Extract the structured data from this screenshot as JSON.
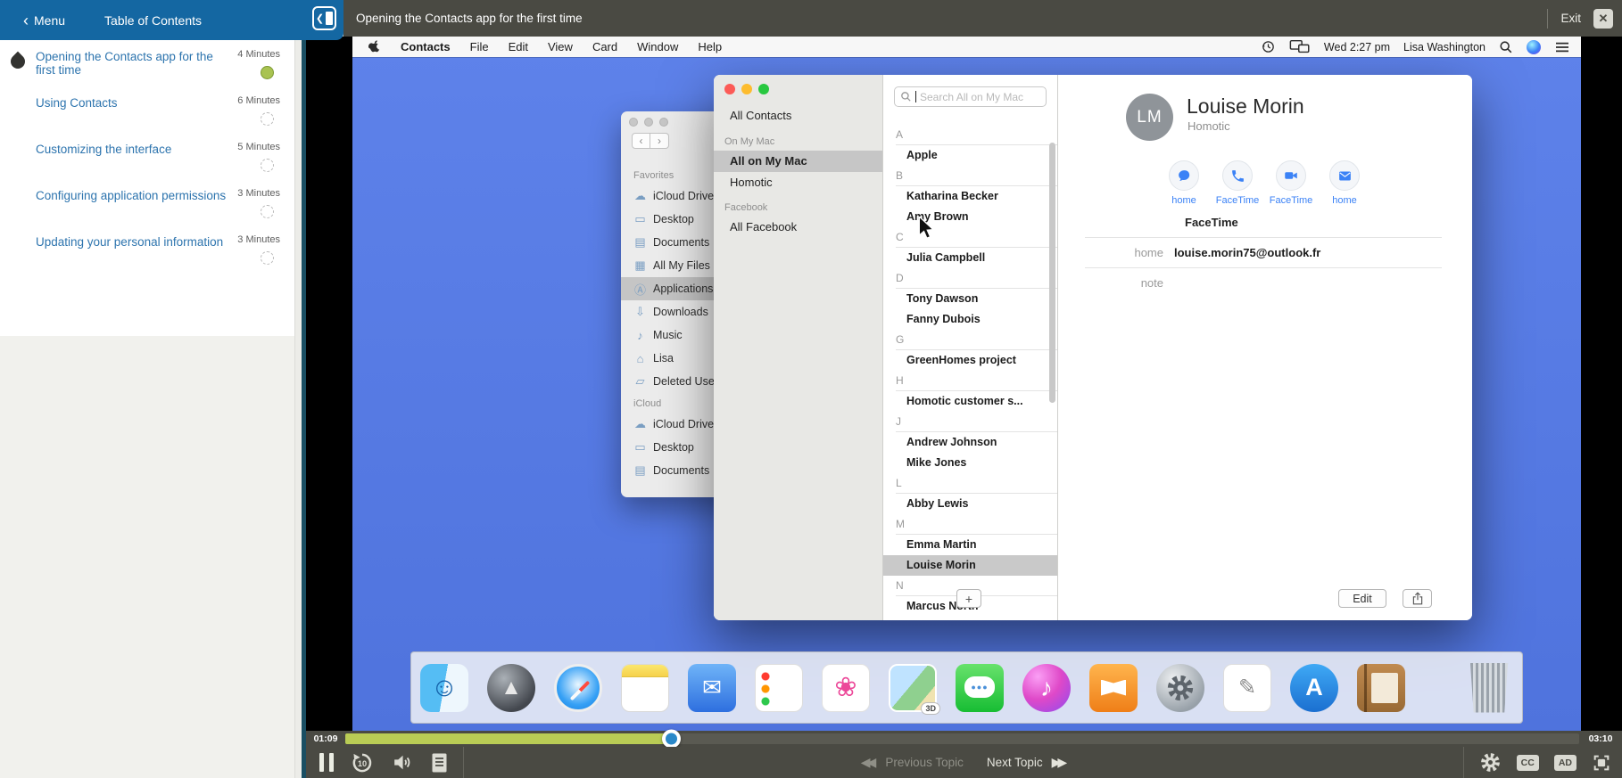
{
  "colors": {
    "header_blue": "#1467a2",
    "toolbar_olive": "#4a4a43",
    "progress_green": "#b9cc55",
    "progress_handle_blue": "#2a88c9",
    "desktop_blue": "#567ae4",
    "toc_link_blue": "#2d74ae",
    "status_done_green": "#a9c351",
    "selection_gray": "#c9c9c9",
    "accent_blue": "#3b82f6"
  },
  "header": {
    "menu_label": "Menu",
    "toc_label": "Table of Contents",
    "lesson_title": "Opening the Contacts app for the first time",
    "exit_label": "Exit"
  },
  "toc": {
    "items": [
      {
        "title": "Opening the Contacts app for the first time",
        "duration": "4 Minutes",
        "status": "current"
      },
      {
        "title": "Using Contacts",
        "duration": "6 Minutes",
        "status": "not-started"
      },
      {
        "title": "Customizing the interface",
        "duration": "5 Minutes",
        "status": "not-started"
      },
      {
        "title": "Configuring application permissions",
        "duration": "3 Minutes",
        "status": "not-started"
      },
      {
        "title": "Updating your personal information",
        "duration": "3 Minutes",
        "status": "not-started"
      }
    ]
  },
  "macos": {
    "menubar": {
      "app_name": "Contacts",
      "menus": [
        "File",
        "Edit",
        "View",
        "Card",
        "Window",
        "Help"
      ],
      "datetime": "Wed 2:27 pm",
      "user": "Lisa Washington"
    },
    "finder": {
      "sections": [
        {
          "label": "Favorites",
          "items": [
            "iCloud Drive",
            "Desktop",
            "Documents",
            "All My Files",
            "Applications",
            "Downloads",
            "Music",
            "Lisa",
            "Deleted Users"
          ]
        },
        {
          "label": "iCloud",
          "items": [
            "iCloud Drive",
            "Desktop",
            "Documents"
          ]
        }
      ],
      "selected_item": "Applications"
    },
    "contacts_app": {
      "groups": {
        "all_contacts_label": "All Contacts",
        "sections": [
          {
            "label": "On My Mac",
            "items": [
              "All on My Mac",
              "Homotic"
            ]
          },
          {
            "label": "Facebook",
            "items": [
              "All Facebook"
            ]
          }
        ],
        "selected": "All on My Mac"
      },
      "list": {
        "search_placeholder": "Search All on My Mac",
        "groups": [
          {
            "letter": "A",
            "names": [
              "Apple"
            ]
          },
          {
            "letter": "B",
            "names": [
              "Katharina Becker",
              "Amy Brown"
            ]
          },
          {
            "letter": "C",
            "names": [
              "Julia Campbell"
            ]
          },
          {
            "letter": "D",
            "names": [
              "Tony Dawson",
              "Fanny Dubois"
            ]
          },
          {
            "letter": "G",
            "names": [
              "GreenHomes project"
            ]
          },
          {
            "letter": "H",
            "names": [
              "Homotic customer s..."
            ]
          },
          {
            "letter": "J",
            "names": [
              "Andrew Johnson",
              "Mike Jones"
            ]
          },
          {
            "letter": "L",
            "names": [
              "Abby Lewis"
            ]
          },
          {
            "letter": "M",
            "names": [
              "Emma Martin",
              "Louise Morin"
            ]
          },
          {
            "letter": "N",
            "names": [
              "Marcus North"
            ]
          }
        ],
        "selected_contact": "Louise Morin"
      },
      "detail": {
        "initials": "LM",
        "name": "Louise Morin",
        "company": "Homotic",
        "actions": [
          {
            "icon": "chat-bubble",
            "label": "home"
          },
          {
            "icon": "phone",
            "label": "FaceTime"
          },
          {
            "icon": "video-camera",
            "label": "FaceTime"
          },
          {
            "icon": "envelope",
            "label": "home"
          }
        ],
        "facetime_heading": "FaceTime",
        "fields": [
          {
            "label": "home",
            "value": "louise.morin75@outlook.fr"
          },
          {
            "label": "note",
            "value": ""
          }
        ]
      },
      "buttons": {
        "add_label": "+",
        "edit_label": "Edit"
      }
    },
    "dock": {
      "apps": [
        "finder",
        "launchpad",
        "safari",
        "notes",
        "mail",
        "reminders",
        "photos",
        "photo-booth",
        "messages",
        "itunes",
        "ibooks",
        "system-preferences",
        "textedit",
        "app-store",
        "contacts"
      ],
      "badge_3d": "3D",
      "trash": "trash"
    }
  },
  "player": {
    "current_time": "01:09",
    "total_time": "03:10",
    "progress_percent": 26.5,
    "rewind_label": "10",
    "previous_label": "Previous Topic",
    "next_label": "Next Topic",
    "cc_label": "CC",
    "ad_label": "AD"
  }
}
